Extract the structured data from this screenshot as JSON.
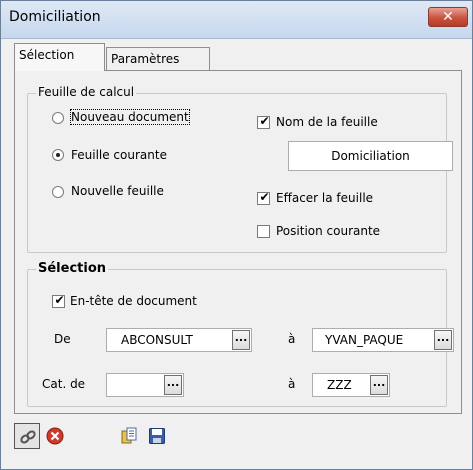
{
  "window": {
    "title": "Domiciliation",
    "close_label": "✕"
  },
  "tabs": [
    {
      "label": "Sélection"
    },
    {
      "label": "Paramètres"
    }
  ],
  "feuille_de_calcul": {
    "legend": "Feuille de calcul",
    "options": {
      "nouveau_document": "Nouveau document",
      "feuille_courante": "Feuille courante",
      "nouvelle_feuille": "Nouvelle feuille"
    },
    "selected": "feuille_courante",
    "nom_de_la_feuille": {
      "label": "Nom de la feuille",
      "checked": true,
      "value": "Domiciliation"
    },
    "effacer_la_feuille": {
      "label": "Effacer la feuille",
      "checked": true
    },
    "position_courante": {
      "label": "Position courante",
      "checked": false
    }
  },
  "selection": {
    "legend": "Sélection",
    "entete": {
      "label": "En-tête de document",
      "checked": true
    },
    "de_label": "De",
    "de_value": "ABCONSULT",
    "a1_label": "à",
    "a1_value": "YVAN_PAQUE",
    "cat_label": "Cat. de",
    "cat_value": "",
    "a2_label": "à",
    "a2_value": "ZZZ",
    "browse_label": "..."
  },
  "toolbar": {
    "buttons": [
      {
        "name": "link-button",
        "icon": "chain-link-icon"
      },
      {
        "name": "cancel-button",
        "icon": "red-x-circle-icon"
      },
      {
        "name": "copy-button",
        "icon": "copy-documents-icon"
      },
      {
        "name": "save-button",
        "icon": "floppy-disk-icon"
      }
    ]
  },
  "checkmark": "✔",
  "colors": {
    "title_bar": "#c6d7ee",
    "close_button": "#c8533f",
    "panel_bg": "#f0f0f0"
  }
}
